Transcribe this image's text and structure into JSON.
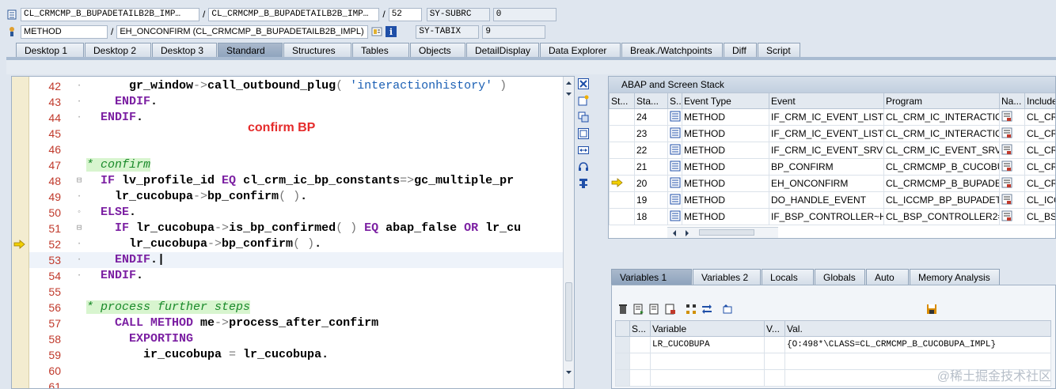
{
  "header": {
    "row1": {
      "program": "CL_CRMCMP_B_BUPADETAILB2B_IMP…",
      "include": "CL_CRMCMP_B_BUPADETAILB2B_IMP…",
      "line": "52",
      "var_name": "SY-SUBRC",
      "var_value": "0"
    },
    "row2": {
      "type": "METHOD",
      "name": "EH_ONCONFIRM (CL_CRMCMP_B_BUPADETAILB2B_IMPL)",
      "var_name": "SY-TABIX",
      "var_value": "9"
    }
  },
  "tabs": [
    "Desktop 1",
    "Desktop 2",
    "Desktop 3",
    "Standard",
    "Structures",
    "Tables",
    "Objects",
    "DetailDisplay",
    "Data Explorer",
    "Break./Watchpoints",
    "Diff",
    "Script"
  ],
  "active_tab": "Standard",
  "annotation": "confirm BP",
  "code": [
    {
      "n": "42",
      "fold": "-",
      "segs": [
        [
          "plain",
          "      gr_window"
        ],
        [
          "op",
          "->"
        ],
        [
          "plain",
          "call_outbound_plug"
        ],
        [
          "op",
          "( "
        ],
        [
          "str",
          "'interactionhistory'"
        ],
        [
          "op",
          " )"
        ]
      ]
    },
    {
      "n": "43",
      "fold": "-",
      "segs": [
        [
          "kw",
          "    ENDIF"
        ],
        [
          "plain",
          "."
        ]
      ]
    },
    {
      "n": "44",
      "fold": "-",
      "segs": [
        [
          "kw",
          "  ENDIF"
        ],
        [
          "plain",
          "."
        ]
      ]
    },
    {
      "n": "45",
      "fold": "",
      "segs": []
    },
    {
      "n": "46",
      "fold": "",
      "segs": []
    },
    {
      "n": "47",
      "fold": "",
      "segs": [
        [
          "cmt",
          "* confirm"
        ]
      ]
    },
    {
      "n": "48",
      "fold": "⊟",
      "segs": [
        [
          "kw",
          "  IF "
        ],
        [
          "plain",
          "lv_profile_id "
        ],
        [
          "kw",
          "EQ"
        ],
        [
          "plain",
          " cl_crm_ic_bp_constants"
        ],
        [
          "op",
          "=>"
        ],
        [
          "plain",
          "gc_multiple_pr"
        ]
      ]
    },
    {
      "n": "49",
      "fold": "-",
      "segs": [
        [
          "plain",
          "    lr_cucobupa"
        ],
        [
          "op",
          "->"
        ],
        [
          "plain",
          "bp_confirm"
        ],
        [
          "op",
          "( )"
        ],
        [
          "plain",
          "."
        ]
      ]
    },
    {
      "n": "50",
      "fold": "◦",
      "segs": [
        [
          "kw",
          "  ELSE"
        ],
        [
          "plain",
          "."
        ]
      ]
    },
    {
      "n": "51",
      "fold": "⊟",
      "segs": [
        [
          "kw",
          "    IF "
        ],
        [
          "plain",
          "lr_cucobupa"
        ],
        [
          "op",
          "->"
        ],
        [
          "plain",
          "is_bp_confirmed"
        ],
        [
          "op",
          "( )"
        ],
        [
          "kw",
          " EQ "
        ],
        [
          "plain",
          "abap_false "
        ],
        [
          "kw",
          "OR"
        ],
        [
          "plain",
          " lr_cu"
        ]
      ]
    },
    {
      "n": "52",
      "fold": "-",
      "segs": [
        [
          "plain",
          "      lr_cucobupa"
        ],
        [
          "op",
          "->"
        ],
        [
          "plain",
          "bp_confirm"
        ],
        [
          "op",
          "( )"
        ],
        [
          "plain",
          "."
        ]
      ]
    },
    {
      "n": "53",
      "fold": "-",
      "segs": [
        [
          "kw",
          "    ENDIF"
        ],
        [
          "plain",
          ".|"
        ]
      ]
    },
    {
      "n": "54",
      "fold": "-",
      "segs": [
        [
          "kw",
          "  ENDIF"
        ],
        [
          "plain",
          "."
        ]
      ]
    },
    {
      "n": "55",
      "fold": "",
      "segs": []
    },
    {
      "n": "56",
      "fold": "",
      "segs": [
        [
          "cmt",
          "* process further steps"
        ]
      ]
    },
    {
      "n": "57",
      "fold": "",
      "segs": [
        [
          "kw",
          "    CALL METHOD"
        ],
        [
          "plain",
          " me"
        ],
        [
          "op",
          "->"
        ],
        [
          "plain",
          "process_after_confirm"
        ]
      ]
    },
    {
      "n": "58",
      "fold": "",
      "segs": [
        [
          "kw",
          "      EXPORTING"
        ]
      ]
    },
    {
      "n": "59",
      "fold": "",
      "segs": [
        [
          "plain",
          "        ir_cucobupa "
        ],
        [
          "op",
          "="
        ],
        [
          "plain",
          " lr_cucobupa."
        ]
      ]
    },
    {
      "n": "60",
      "fold": "",
      "segs": []
    },
    {
      "n": "61",
      "fold": "",
      "segs": []
    }
  ],
  "current_line": "52",
  "stack": {
    "title": "ABAP and Screen Stack",
    "columns": [
      "St...",
      "Sta...",
      "S...",
      "Event Type",
      "Event",
      "Program",
      "Na...",
      "Include"
    ],
    "rows": [
      {
        "st": "",
        "level": "24",
        "type": "METHOD",
        "event": "IF_CRM_IC_EVENT_LIST…",
        "program": "CL_CRM_IC_INTERACTIO…",
        "inc": "CL_CRM"
      },
      {
        "st": "",
        "level": "23",
        "type": "METHOD",
        "event": "IF_CRM_IC_EVENT_LIST…",
        "program": "CL_CRM_IC_INTERACTIO…",
        "inc": "CL_CRM"
      },
      {
        "st": "",
        "level": "22",
        "type": "METHOD",
        "event": "IF_CRM_IC_EVENT_SRV…",
        "program": "CL_CRM_IC_EVENT_SRV…",
        "inc": "CL_CRM"
      },
      {
        "st": "",
        "level": "21",
        "type": "METHOD",
        "event": "BP_CONFIRM",
        "program": "CL_CRMCMP_B_CUCOBU…",
        "inc": "CL_CRM"
      },
      {
        "st": "current",
        "level": "20",
        "type": "METHOD",
        "event": "EH_ONCONFIRM",
        "program": "CL_CRMCMP_B_BUPADE…",
        "inc": "CL_CRM"
      },
      {
        "st": "",
        "level": "19",
        "type": "METHOD",
        "event": "DO_HANDLE_EVENT",
        "program": "CL_ICCMP_BP_BUPADET…",
        "inc": "CL_ICC"
      },
      {
        "st": "",
        "level": "18",
        "type": "METHOD",
        "event": "IF_BSP_CONTROLLER~H…",
        "program": "CL_BSP_CONTROLLER2=…",
        "inc": "CL_BSP"
      }
    ]
  },
  "var_tabs": [
    "Variables 1",
    "Variables 2",
    "Locals",
    "Globals",
    "Auto",
    "Memory Analysis"
  ],
  "active_var_tab": "Variables 1",
  "vars": {
    "columns": [
      "S...",
      "Variable",
      "V...",
      "Val."
    ],
    "rows": [
      {
        "name": "LR_CUCOBUPA",
        "value": "{O:498*\\CLASS=CL_CRMCMP_B_CUCOBUPA_IMPL}"
      }
    ]
  },
  "watermark": "@稀土掘金技术社区"
}
